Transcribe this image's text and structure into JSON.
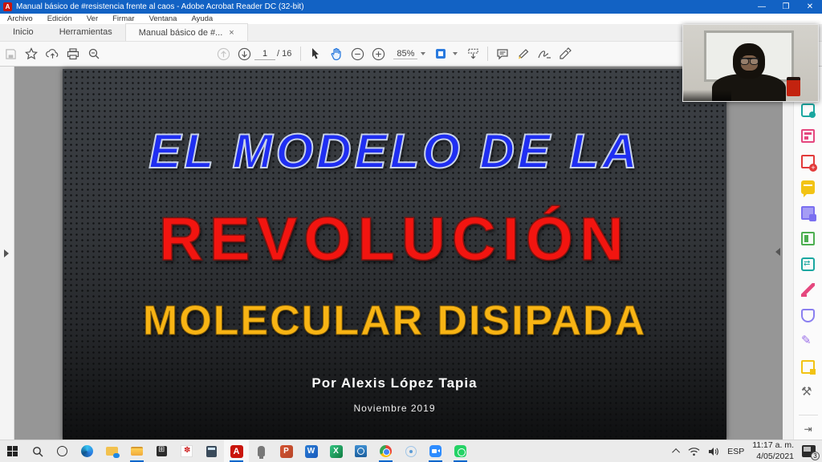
{
  "window": {
    "title": "Manual básico de #resistencia frente al caos - Adobe Acrobat Reader DC (32-bit)",
    "app_initial": "A",
    "controls": {
      "minimize": "—",
      "maximize": "❐",
      "close": "✕"
    }
  },
  "menu": {
    "items": [
      "Archivo",
      "Edición",
      "Ver",
      "Firmar",
      "Ventana",
      "Ayuda"
    ]
  },
  "tabs": {
    "home": "Inicio",
    "tools": "Herramientas",
    "document": "Manual básico de #...",
    "close_glyph": "×"
  },
  "toolbar": {
    "page_current": "1",
    "page_total": "/ 16",
    "zoom_level": "85%",
    "icons": [
      "save-icon",
      "favorite-star-icon",
      "share-cloud-icon",
      "print-icon",
      "find-icon",
      "page-up-icon",
      "page-down-icon",
      "select-tool-icon",
      "hand-tool-icon",
      "zoom-out-icon",
      "zoom-in-icon",
      "fit-page-icon",
      "scroll-mode-icon",
      "comment-icon",
      "highlight-icon",
      "sign-icon",
      "stamp-icon"
    ]
  },
  "slide": {
    "title_line1": "EL MODELO DE LA",
    "title_line2": "REVOLUCIÓN",
    "title_line3": "MOLECULAR DISIPADA",
    "author": "Por Alexis López Tapia",
    "date": "Noviembre 2019",
    "colors": {
      "line1": "#1f2ef2",
      "line2": "#f21510",
      "line3": "#f8b414",
      "background": "#323538"
    }
  },
  "tools_panel": {
    "items": [
      "export-pdf",
      "edit-pdf",
      "create-pdf",
      "comment",
      "combine-files",
      "organize-pages",
      "compress-pdf",
      "redact",
      "protect",
      "fill-sign",
      "request-signatures",
      "more-tools"
    ],
    "collapse_glyph": "⇥"
  },
  "taskbar": {
    "apps": [
      "start",
      "search",
      "cortana",
      "edge",
      "onedrive-folder",
      "file-explorer",
      "microsoft-store",
      "rewards",
      "calculator",
      "acrobat-reader",
      "voice-recorder",
      "powerpoint",
      "word",
      "excel",
      "remote-app",
      "chrome",
      "capture-app",
      "zoom-app",
      "whatsapp"
    ],
    "acrobat_initial": "A",
    "office_initials": {
      "powerpoint": "P",
      "word": "W",
      "excel": "X"
    },
    "tray": {
      "language": "ESP",
      "time": "11:17 a. m.",
      "date": "4/05/2021",
      "notification_count": "3"
    }
  }
}
